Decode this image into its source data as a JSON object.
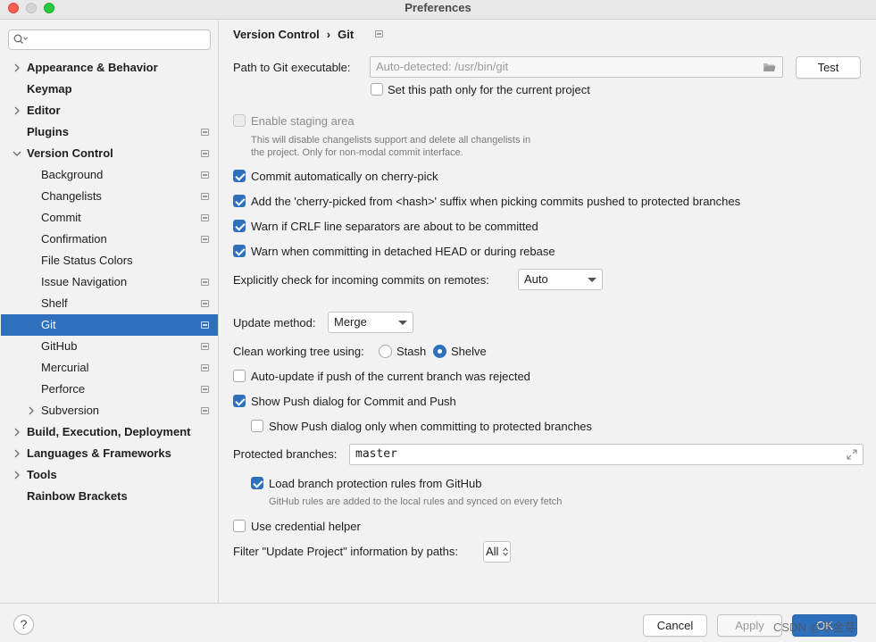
{
  "window": {
    "title": "Preferences"
  },
  "search": {
    "placeholder": ""
  },
  "sidebar": {
    "items": [
      {
        "label": "Appearance & Behavior"
      },
      {
        "label": "Keymap"
      },
      {
        "label": "Editor"
      },
      {
        "label": "Plugins"
      },
      {
        "label": "Version Control"
      },
      {
        "label": "Background"
      },
      {
        "label": "Changelists"
      },
      {
        "label": "Commit"
      },
      {
        "label": "Confirmation"
      },
      {
        "label": "File Status Colors"
      },
      {
        "label": "Issue Navigation"
      },
      {
        "label": "Shelf"
      },
      {
        "label": "Git"
      },
      {
        "label": "GitHub"
      },
      {
        "label": "Mercurial"
      },
      {
        "label": "Perforce"
      },
      {
        "label": "Subversion"
      },
      {
        "label": "Build, Execution, Deployment"
      },
      {
        "label": "Languages & Frameworks"
      },
      {
        "label": "Tools"
      },
      {
        "label": "Rainbow Brackets"
      }
    ]
  },
  "breadcrumb": {
    "parent": "Version Control",
    "separator": "›",
    "current": "Git"
  },
  "git": {
    "path_label": "Path to Git executable:",
    "path_placeholder": "Auto-detected: /usr/bin/git",
    "test_label": "Test",
    "path_project_only": "Set this path only for the current project",
    "staging_label": "Enable staging area",
    "staging_hint_1": "This will disable changelists support and delete all changelists in",
    "staging_hint_2": "the project. Only for non-modal commit interface.",
    "cherry_pick": "Commit automatically on cherry-pick",
    "cherry_suffix": "Add the 'cherry-picked from <hash>' suffix when picking commits pushed to protected branches",
    "crlf": "Warn if CRLF line separators are about to be committed",
    "detached": "Warn when committing in detached HEAD or during rebase",
    "incoming_label": "Explicitly check for incoming commits on remotes:",
    "incoming_value": "Auto",
    "update_method_label": "Update method:",
    "update_method_value": "Merge",
    "clean_tree_label": "Clean working tree using:",
    "stash_label": "Stash",
    "shelve_label": "Shelve",
    "auto_update": "Auto-update if push of the current branch was rejected",
    "show_push": "Show Push dialog for Commit and Push",
    "show_push_protected": "Show Push dialog only when committing to protected branches",
    "protected_label": "Protected branches:",
    "protected_value": "master",
    "load_rules": "Load branch protection rules from GitHub",
    "load_rules_hint": "GitHub rules are added to the local rules and synced on every fetch",
    "credential": "Use credential helper",
    "filter_label": "Filter \"Update Project\" information by paths:",
    "filter_value": "All"
  },
  "footer": {
    "help": "?",
    "cancel": "Cancel",
    "apply": "Apply",
    "ok": "OK",
    "watermark": "CSDN @寒金芽"
  },
  "colors": {
    "accent": "#2f70bd",
    "window_bg": "#f2f2f2"
  }
}
